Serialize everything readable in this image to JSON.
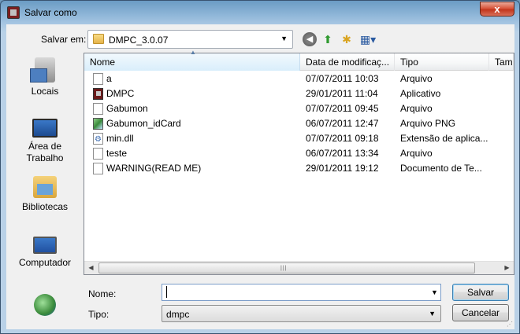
{
  "window": {
    "title": "Salvar como",
    "close_glyph": "x"
  },
  "lookin": {
    "label": "Salvar em:",
    "value": "DMPC_3.0.07"
  },
  "places": [
    {
      "label": "Locais",
      "icon": "recent-places-icon"
    },
    {
      "label": "Área de\nTrabalho",
      "icon": "desktop-icon"
    },
    {
      "label": "Bibliotecas",
      "icon": "libraries-icon"
    },
    {
      "label": "Computador",
      "icon": "computer-icon"
    },
    {
      "label": "",
      "icon": "network-icon"
    }
  ],
  "columns": {
    "name": "Nome",
    "date": "Data de modificaç...",
    "type": "Tipo",
    "size": "Tam"
  },
  "files": [
    {
      "name": "a",
      "date": "07/07/2011 10:03",
      "type": "Arquivo",
      "icon": "file-icon"
    },
    {
      "name": "DMPC",
      "date": "29/01/2011 11:04",
      "type": "Aplicativo",
      "icon": "application-icon"
    },
    {
      "name": "Gabumon",
      "date": "07/07/2011 09:45",
      "type": "Arquivo",
      "icon": "file-icon"
    },
    {
      "name": "Gabumon_idCard",
      "date": "06/07/2011 12:47",
      "type": "Arquivo PNG",
      "icon": "image-icon"
    },
    {
      "name": "min.dll",
      "date": "07/07/2011 09:18",
      "type": "Extensão de aplica...",
      "icon": "dll-icon"
    },
    {
      "name": "teste",
      "date": "06/07/2011 13:34",
      "type": "Arquivo",
      "icon": "file-icon"
    },
    {
      "name": "WARNING(READ ME)",
      "date": "29/01/2011 19:12",
      "type": "Documento de Te...",
      "icon": "text-file-icon"
    }
  ],
  "form": {
    "name_label": "Nome:",
    "name_value": "",
    "type_label": "Tipo:",
    "type_value": "dmpc"
  },
  "buttons": {
    "save": "Salvar",
    "cancel": "Cancelar"
  }
}
